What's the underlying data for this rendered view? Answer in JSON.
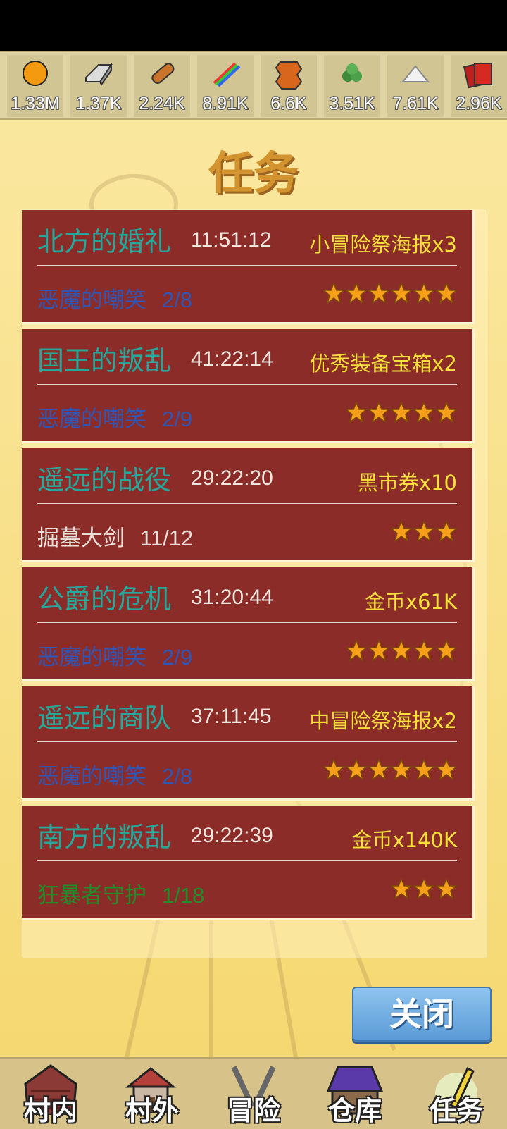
{
  "resources": [
    {
      "icon": "gold-coin-icon",
      "value": "1.33M"
    },
    {
      "icon": "iron-ingot-icon",
      "value": "1.37K"
    },
    {
      "icon": "wood-log-icon",
      "value": "2.24K"
    },
    {
      "icon": "rainbow-crystal-icon",
      "value": "8.91K"
    },
    {
      "icon": "leather-hide-icon",
      "value": "6.6K"
    },
    {
      "icon": "herb-icon",
      "value": "3.51K"
    },
    {
      "icon": "salt-pile-icon",
      "value": "7.61K"
    },
    {
      "icon": "cards-icon",
      "value": "2.96K"
    }
  ],
  "title": "任务",
  "quests": [
    {
      "name": "北方的婚礼",
      "timer": "11:51:12",
      "reward": "小冒险祭海报x3",
      "enemy": "恶魔的嘲笑",
      "progress": "2/8",
      "enemy_color": "#2f55b5",
      "stars": 6
    },
    {
      "name": "国王的叛乱",
      "timer": "41:22:14",
      "reward": "优秀装备宝箱x2",
      "enemy": "恶魔的嘲笑",
      "progress": "2/9",
      "enemy_color": "#2f55b5",
      "stars": 5
    },
    {
      "name": "遥远的战役",
      "timer": "29:22:20",
      "reward": "黑市券x10",
      "enemy": "掘墓大剑",
      "progress": "11/12",
      "enemy_color": "#e8e0d8",
      "stars": 3
    },
    {
      "name": "公爵的危机",
      "timer": "31:20:44",
      "reward": "金币x61K",
      "enemy": "恶魔的嘲笑",
      "progress": "2/9",
      "enemy_color": "#2f55b5",
      "stars": 5
    },
    {
      "name": "遥远的商队",
      "timer": "37:11:45",
      "reward": "中冒险祭海报x2",
      "enemy": "恶魔的嘲笑",
      "progress": "2/8",
      "enemy_color": "#2f55b5",
      "stars": 6
    },
    {
      "name": "南方的叛乱",
      "timer": "29:22:39",
      "reward": "金币x140K",
      "enemy": "狂暴者守护",
      "progress": "1/18",
      "enemy_color": "#1f8f2a",
      "stars": 3
    }
  ],
  "close_label": "关闭",
  "nav": [
    {
      "label": "村内",
      "icon": "village-inside-icon"
    },
    {
      "label": "村外",
      "icon": "village-outside-icon"
    },
    {
      "label": "冒险",
      "icon": "adventure-icon"
    },
    {
      "label": "仓库",
      "icon": "warehouse-icon"
    },
    {
      "label": "任务",
      "icon": "quest-icon"
    }
  ],
  "colors": {
    "quest_bg": "#8b2c29",
    "quest_name": "#26a79c",
    "reward": "#f7e03a",
    "title": "#d3932f",
    "close_button": "#6aaae0"
  }
}
